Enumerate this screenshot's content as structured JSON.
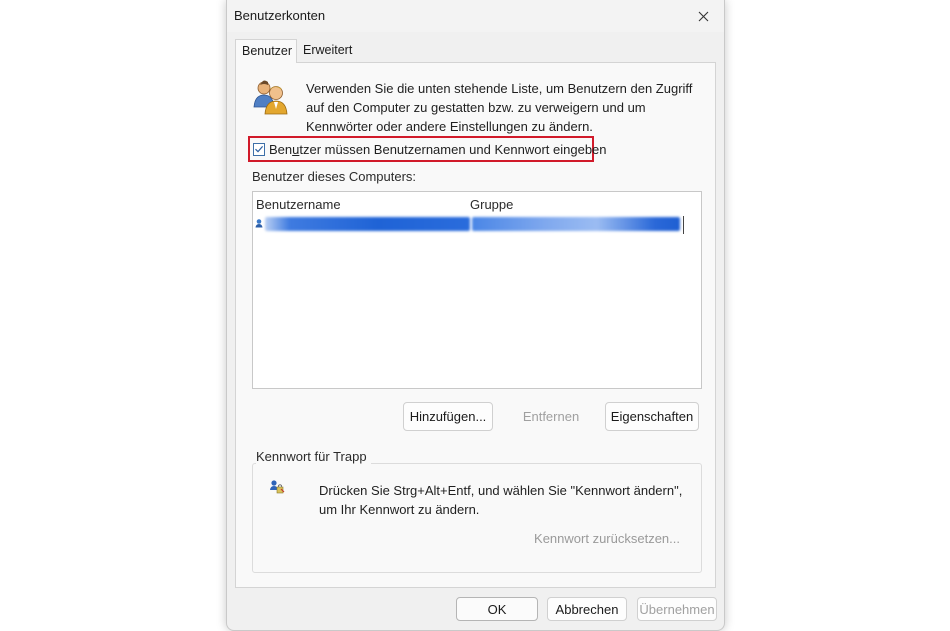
{
  "window": {
    "title": "Benutzerkonten"
  },
  "tabs": [
    {
      "label": "Benutzer",
      "active": true
    },
    {
      "label": "Erweitert",
      "active": false
    }
  ],
  "intro": {
    "icon": "users-icon",
    "text": "Verwenden Sie die unten stehende Liste, um Benutzern den Zugriff auf den Computer zu gestatten bzw. zu verweigern und um Kennwörter oder andere Einstellungen zu ändern."
  },
  "require_login": {
    "checked": true,
    "label_pre": "Ben",
    "label_accel": "u",
    "label_post": "tzer müssen Benutzernamen und Kennwort eingeben"
  },
  "users": {
    "heading": "Benutzer dieses Computers:",
    "columns": [
      "Benutzername",
      "Gruppe"
    ],
    "rows": [
      {
        "username": "",
        "group": "",
        "selected": true,
        "redacted": true
      }
    ]
  },
  "list_buttons": {
    "add": "Hinzufügen...",
    "remove": "Entfernen",
    "properties": "Eigenschaften"
  },
  "password": {
    "group_title": "Kennwort für Trapp",
    "icon": "password-key-icon",
    "text": "Drücken Sie Strg+Alt+Entf, und wählen Sie \"Kennwort ändern\", um Ihr Kennwort zu ändern.",
    "reset_label": "Kennwort zurücksetzen..."
  },
  "footer": {
    "ok": "OK",
    "cancel": "Abbrechen",
    "apply": "Übernehmen"
  },
  "colors": {
    "highlight_border": "#d11a2a",
    "selection": "#1f63d6",
    "disabled_text": "#a0a0a0"
  }
}
